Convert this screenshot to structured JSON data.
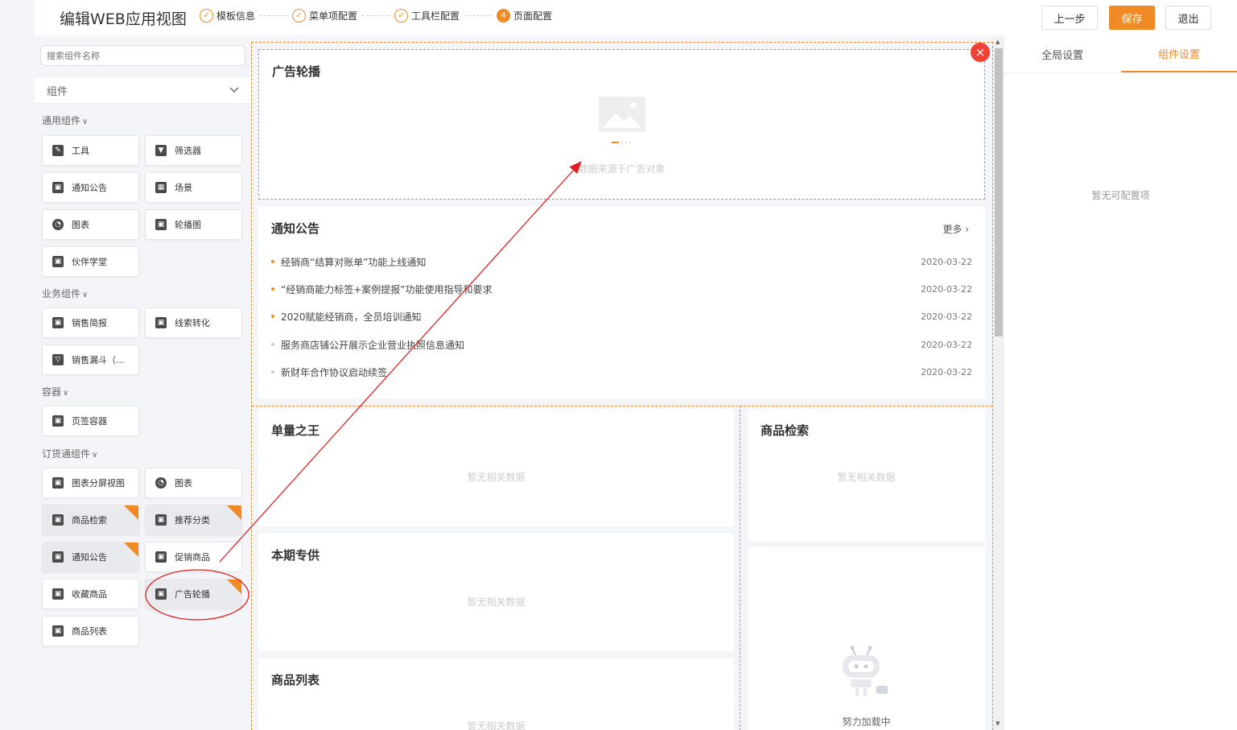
{
  "header": {
    "title": "编辑WEB应用视图",
    "steps": [
      {
        "label": "模板信息",
        "mark": "✓"
      },
      {
        "label": "菜单项配置",
        "mark": "✓"
      },
      {
        "label": "工具栏配置",
        "mark": "✓"
      },
      {
        "label": "页面配置",
        "mark": "4"
      }
    ],
    "prev_label": "上一步",
    "save_label": "保存",
    "exit_label": "退出"
  },
  "sidebar": {
    "search_placeholder": "搜索组件名称",
    "dropdown_label": "组件",
    "groups": [
      {
        "title": "通用组件",
        "items": [
          "工具",
          "筛选器",
          "通知公告",
          "场景",
          "图表",
          "轮播图",
          "伙伴学堂"
        ]
      },
      {
        "title": "业务组件",
        "items": [
          "销售简报",
          "线索转化",
          "销售漏斗（..."
        ]
      },
      {
        "title": "容器",
        "items": [
          "页签容器"
        ]
      },
      {
        "title": "订货通组件",
        "items": [
          "图表分屏视图",
          "图表",
          "商品检索",
          "推荐分类",
          "通知公告",
          "促销商品",
          "收藏商品",
          "广告轮播",
          "商品列表"
        ]
      }
    ]
  },
  "canvas": {
    "banner": {
      "title": "广告轮播",
      "source_text": "数据来源于广告对象",
      "close_glyph": "×"
    },
    "notice": {
      "title": "通知公告",
      "more": "更多 ›",
      "rows": [
        {
          "text": "经销商“结算对账单”功能上线通知",
          "date": "2020-03-22"
        },
        {
          "text": "“经销商能力标签+案例提报”功能使用指导和要求",
          "date": "2020-03-22"
        },
        {
          "text": "2020赋能经销商，全员培训通知",
          "date": "2020-03-22"
        },
        {
          "text": "服务商店铺公开展示企业营业执照信息通知",
          "date": "2020-03-22"
        },
        {
          "text": "新财年合作协议启动续签",
          "date": "2020-03-22"
        }
      ]
    },
    "single_king": {
      "title": "单量之王",
      "empty": "暂无相关数据"
    },
    "current_supply": {
      "title": "本期专供",
      "empty": "暂无相关数据"
    },
    "product_list": {
      "title": "商品列表",
      "empty": "暂无相关数据"
    },
    "product_search": {
      "title": "商品检索",
      "empty": "暂无相关数据"
    },
    "loading": {
      "text": "努力加载中"
    }
  },
  "right_panel": {
    "tabs": [
      "全局设置",
      "组件设置"
    ],
    "active_tab": "组件设置",
    "empty": "暂无可配置项"
  },
  "colors": {
    "accent": "#f08a24",
    "close": "#f04134",
    "annotation": "#e02020"
  }
}
